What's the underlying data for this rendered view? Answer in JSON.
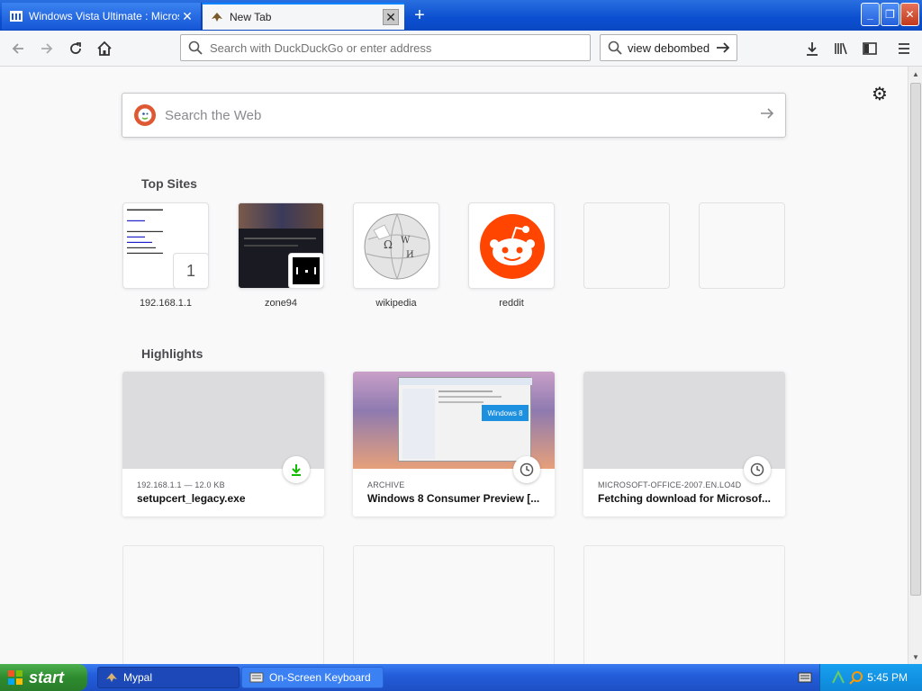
{
  "browser": {
    "tabs": [
      {
        "label": "Windows Vista Ultimate : Microsof",
        "active": false
      },
      {
        "label": "New Tab",
        "active": true
      }
    ],
    "url_placeholder": "Search with DuckDuckGo or enter address",
    "search_box_value": "view debombed"
  },
  "newtab": {
    "web_search_placeholder": "Search the Web",
    "top_sites_title": "Top Sites",
    "top_sites": [
      {
        "label": "192.168.1.1",
        "badge": "1"
      },
      {
        "label": "zone94"
      },
      {
        "label": "wikipedia"
      },
      {
        "label": "reddit"
      },
      {
        "label": ""
      },
      {
        "label": ""
      }
    ],
    "highlights_title": "Highlights",
    "highlights": [
      {
        "context": "192.168.1.1 — 12.0 KB",
        "title": "setupcert_legacy.exe",
        "icon": "download-icon"
      },
      {
        "context": "ARCHIVE",
        "title": "Windows 8 Consumer Preview [...",
        "icon": "clock-icon"
      },
      {
        "context": "MICROSOFT-OFFICE-2007.EN.LO4D",
        "title": "Fetching download for Microsof...",
        "icon": "clock-icon"
      }
    ]
  },
  "taskbar": {
    "start_label": "start",
    "tasks": [
      {
        "label": "Mypal"
      },
      {
        "label": "On-Screen Keyboard"
      }
    ],
    "clock": "5:45 PM"
  },
  "colors": {
    "accent": "#0a84ff",
    "download_green": "#12bc00",
    "reddit": "#ff4500",
    "ddg": "#de5833"
  }
}
